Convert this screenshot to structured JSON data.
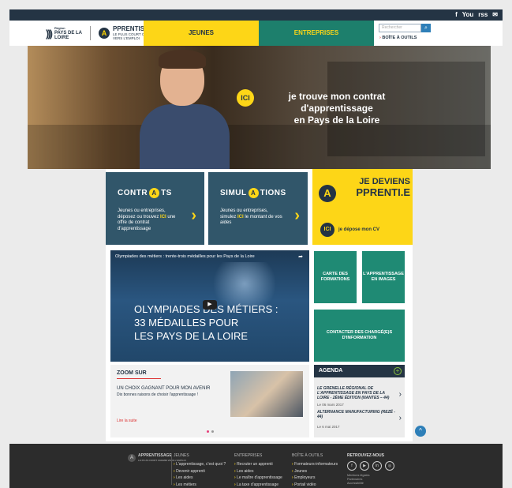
{
  "topbar": {
    "social_icons": [
      "f",
      "You",
      "rss",
      "✉"
    ]
  },
  "header": {
    "logo_region_line1": "Région",
    "logo_region_line2": "PAYS DE LA",
    "logo_region_line3": "LOIRE",
    "logo_app_letter": "A",
    "logo_app_title": "PPRENTISSAGE",
    "logo_app_sub1": "LE PLUS COURT CHEMIN",
    "logo_app_sub2": "VERS L'EMPLOI",
    "nav_jeunes": "JEUNES",
    "nav_entreprises": "ENTREPRISES",
    "search_placeholder": "Rechercher",
    "search_icon": "magnifier",
    "tools_label": "BOÎTE À OUTILS"
  },
  "hero": {
    "badge": "ICI",
    "text_line1": "je trouve mon contrat",
    "text_line2": "d'apprentissage",
    "text_line3": "en Pays de la Loire"
  },
  "tiles": {
    "contrats": {
      "title_a": "CONTR",
      "title_dot": "A",
      "title_b": "TS",
      "desc_1": "Jeunes ou entreprises, déposez ou trouvez ",
      "desc_ici": "ICI",
      "desc_2": " une offre de contrat d'apprentissage"
    },
    "simulations": {
      "title_a": "SIMUL",
      "title_dot": "A",
      "title_b": "TIONS",
      "desc_1": "Jeunes ou entreprises, simulez ",
      "desc_ici": "ICI",
      "desc_2": " le montant de vos aides"
    },
    "apprenti": {
      "line1": "JE DEVIENS",
      "line2": "PPRENTI.E",
      "letter": "A",
      "ici": "ICI",
      "cv": "je dépose mon CV"
    }
  },
  "video": {
    "title": "Olympiades des métiers : trente-trois médailles pour les Pays de la Loire",
    "share": "➦",
    "big_line1": "OLYMPIADES DES MÉTIERS :",
    "big_line2": "33 MÉDAILLES POUR",
    "big_line3": "LES PAYS DE LA LOIRE",
    "play": "▶"
  },
  "side_tiles": {
    "carte": "CARTE DES FORMATIONS",
    "images": "L'APPRENTISSAGE EN IMAGES",
    "contact": "CONTACTER DES CHARGÉ(E)S D'INFORMATION"
  },
  "zoom": {
    "heading": "ZOOM SUR",
    "title": "UN CHOIX GAGNANT POUR MON AVENIR",
    "subtitle": "Dix bonnes raisons de choisir l'apprentissage !",
    "more": "Lire la suite"
  },
  "agenda": {
    "heading": "AGENDA",
    "plus": "+",
    "items": [
      {
        "title": "LE GRENELLE RÉGIONAL DE L'APPRENTISSAGE EN PAYS DE LA LOIRE - 2ÈME ÉDITION (NANTES – 44)",
        "date": "Le 06 mars 2017"
      },
      {
        "title": "ALTERNANCE MANUFACTURING (REZÉ - 44)",
        "date": "Le 6 mai 2017"
      }
    ]
  },
  "scroll_top": "^",
  "footer": {
    "logo_title": "APPRENTISSAGE",
    "logo_sub": "LE PLUS COURT CHEMIN VERS L'EMPLOI",
    "col1": {
      "head": "JEUNES",
      "links": [
        "L'apprentissage, c'est quoi ?",
        "Devenir apprenti",
        "Les aides",
        "Les métiers"
      ]
    },
    "col2": {
      "head": "ENTREPRISES",
      "links": [
        "Recruter un apprenti",
        "Les aides",
        "Le maître d'apprentissage",
        "La taxe d'apprentissage"
      ]
    },
    "col3": {
      "head": "BOÎTE À OUTILS",
      "links": [
        "Formateurs-informateurs",
        "Jeunes",
        "Employeurs",
        "Portail vidéo"
      ]
    },
    "col4": {
      "head": "RETROUVEZ-NOUS",
      "social": [
        "f",
        "▶",
        "in",
        "◎"
      ],
      "small": [
        "Mentions légales",
        "Partenaires",
        "Accessibilité"
      ]
    }
  }
}
